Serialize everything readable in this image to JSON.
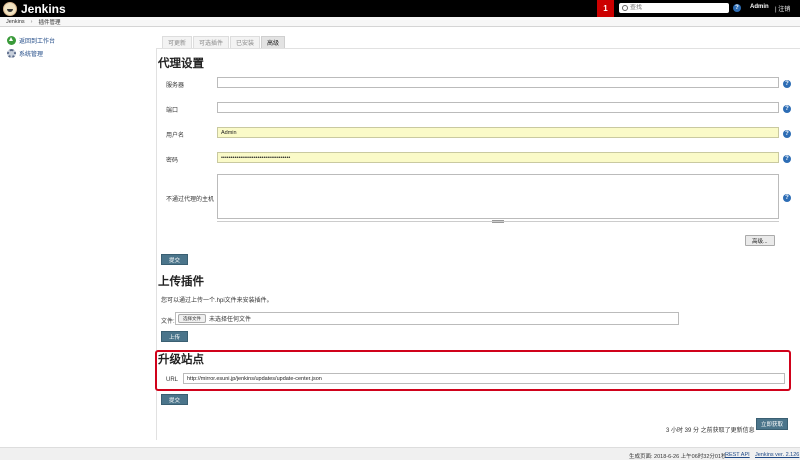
{
  "header": {
    "brand": "Jenkins",
    "notification_count": "1",
    "search_placeholder": "查找",
    "help_glyph": "?",
    "user": "Admin",
    "logout": "| 注销"
  },
  "breadcrumb": {
    "root": "Jenkins",
    "separator": "›",
    "current": "插件管理"
  },
  "sidebar": {
    "items": [
      {
        "label": "返回到工作台",
        "icon": "up-arrow-icon"
      },
      {
        "label": "系统管理",
        "icon": "gear-icon"
      }
    ]
  },
  "tabs": [
    {
      "label": "可更新",
      "active": false
    },
    {
      "label": "可选插件",
      "active": false
    },
    {
      "label": "已安装",
      "active": false
    },
    {
      "label": "高级",
      "active": true
    }
  ],
  "proxy": {
    "title": "代理设置",
    "server_label": "服务器",
    "server_value": "",
    "port_label": "端口",
    "port_value": "",
    "username_label": "用户名",
    "username_value": "Admin",
    "password_label": "密码",
    "password_value": "••••••••••••••••••••••••••••••••••••",
    "no_proxy_label": "不通过代理的主机",
    "no_proxy_value": "",
    "advanced_button": "高级...",
    "submit_button": "提交"
  },
  "upload": {
    "title": "上传插件",
    "description": "您可以通过上传一个.hpi文件来安装插件。",
    "file_label": "文件:",
    "choose_file_button": "选择文件",
    "no_file_text": "未选择任何文件",
    "upload_button": "上传"
  },
  "update_site": {
    "title": "升级站点",
    "url_label": "URL",
    "url_value": "http://mirror.esuni.jp/jenkins/updates/update-center.json",
    "submit_button": "提交"
  },
  "update_info": {
    "text": "3 小时 39 分 之前获取了更新信息",
    "check_now_button": "立即获取"
  },
  "footer": {
    "generated": "生成页面: 2018-6-26 上午06时32分01秒",
    "rest_api": "REST API",
    "version": "Jenkins ver. 2.126"
  },
  "colors": {
    "header_bg": "#000000",
    "notification_bg": "#cc0000",
    "button_blue": "#4b758b",
    "filled_input": "#fafac8",
    "highlight_border": "#d0021b",
    "help_blue": "#2d6db5"
  }
}
